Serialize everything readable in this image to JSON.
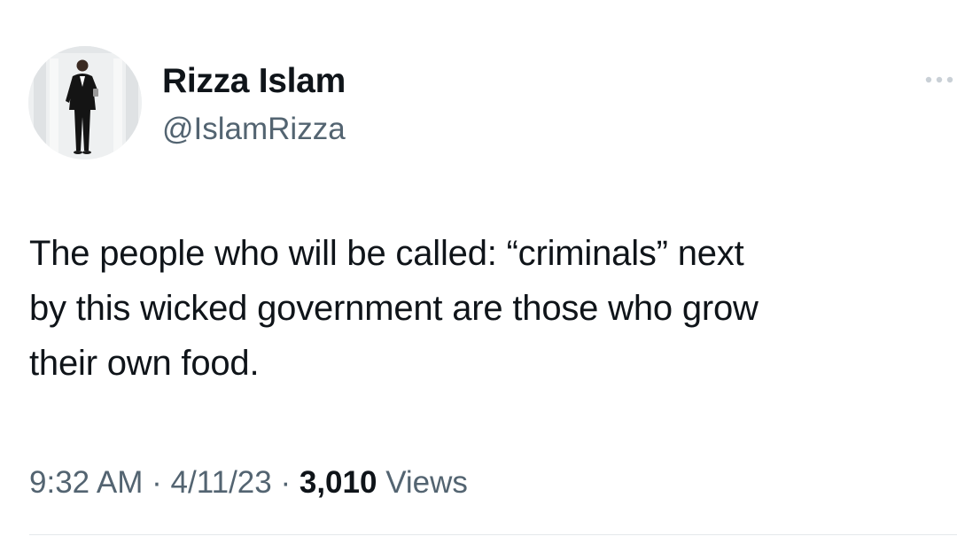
{
  "tweet": {
    "display_name": "Rizza Islam",
    "handle": "@IslamRizza",
    "more_icon": "ellipsis-icon",
    "text": "The people who will be called: “criminals” next\nby this wicked government are those who grow\ntheir own food.",
    "time": "9:32 AM",
    "separator": "·",
    "date": "4/11/23",
    "views_count": "3,010",
    "views_label": "Views"
  },
  "colors": {
    "text_primary": "#0f1419",
    "text_secondary": "#536471",
    "divider": "#e4e8eb"
  }
}
